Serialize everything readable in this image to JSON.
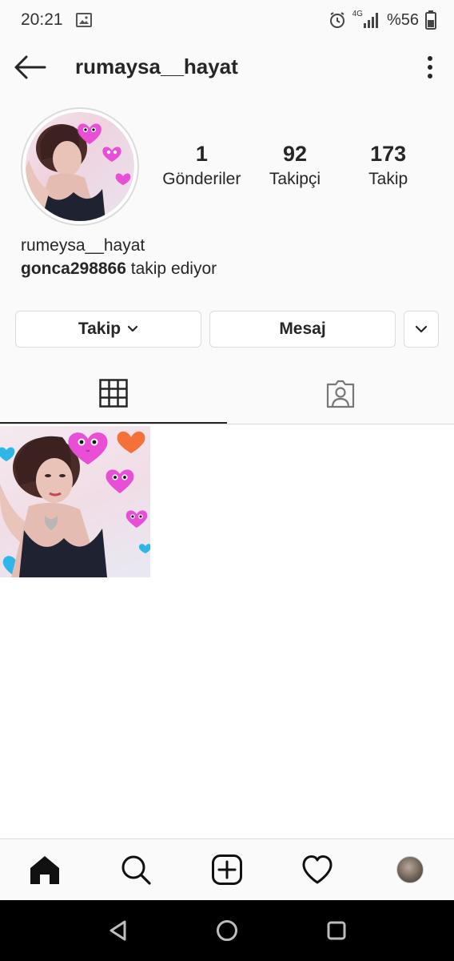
{
  "status_bar": {
    "time": "20:21",
    "network": "4G",
    "battery": "%56",
    "icons": [
      "image-icon",
      "alarm-icon",
      "signal-icon",
      "battery-icon"
    ]
  },
  "header": {
    "username": "rumaysa__hayat",
    "back_icon": "arrow-left-icon",
    "more_icon": "more-vertical-icon"
  },
  "profile": {
    "stats": [
      {
        "value": "1",
        "label": "Gönderiler"
      },
      {
        "value": "92",
        "label": "Takipçi"
      },
      {
        "value": "173",
        "label": "Takip"
      }
    ],
    "name": "rumeysa__hayat",
    "followed_by_user": "gonca298866",
    "followed_by_text": " takip ediyor"
  },
  "actions": {
    "follow_label": "Takip",
    "message_label": "Mesaj"
  },
  "tabs": [
    {
      "icon": "grid-icon",
      "active": true
    },
    {
      "icon": "tagged-icon",
      "active": false
    }
  ],
  "posts_count": 1,
  "bottom_nav": [
    "home-icon",
    "search-icon",
    "add-post-icon",
    "heart-icon",
    "profile-avatar"
  ],
  "system_nav": [
    "back-triangle-icon",
    "home-circle-icon",
    "recents-square-icon"
  ],
  "colors": {
    "text": "#262626",
    "border": "#dbdbdb",
    "background": "#fafafa",
    "heart_pink": "#e84fd6",
    "heart_orange": "#f4723a",
    "heart_blue": "#2fb6e8"
  }
}
